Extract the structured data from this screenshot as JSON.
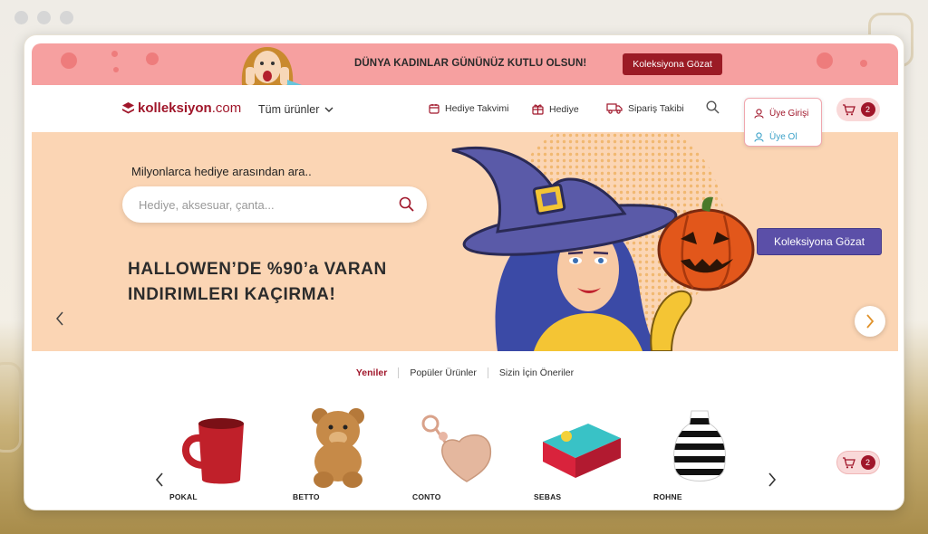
{
  "promo": {
    "message": "DÜNYA KADINLAR GÜNÜNÜZ KUTLU OLSUN!",
    "button": "Koleksiyona Gözat"
  },
  "nav": {
    "logo_main": "kolleksiyon",
    "logo_suffix": ".com",
    "all_products": "Tüm ürünler",
    "links": [
      "Hediye Takvimi",
      "Hediye",
      "Sipariş Takibi"
    ],
    "login": "Üye Girişi",
    "signup": "Üye Ol",
    "cart_count": "2"
  },
  "hero": {
    "label": "Milyonlarca hediye arasından ara..",
    "search_placeholder": "Hediye, aksesuar, çanta...",
    "title_line1": "HALLOWEN’DE %90’a VARAN",
    "title_line2": "INDIRIMLERI KAÇIRMA!",
    "cta": "Koleksiyona Gözat"
  },
  "tabs": [
    "Yeniler",
    "Popüler Ürünler",
    "Sizin İçin Öneriler"
  ],
  "products": [
    "POKAL",
    "BETTO",
    "CONTO",
    "SEBAS",
    "ROHNE"
  ],
  "floating_cart_count": "2",
  "colors": {
    "brand": "#a0162a",
    "promo_bg": "#f6a0a0",
    "hero_bg": "#fbd5b4",
    "cta": "#5b4fa8"
  }
}
